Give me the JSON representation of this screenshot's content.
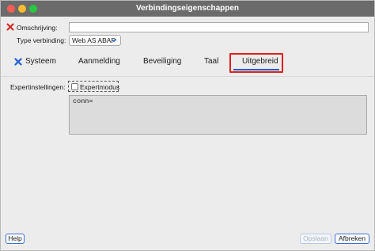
{
  "window": {
    "title": "Verbindingseigenschappen"
  },
  "form": {
    "omschrijving_label": "Omschrijving:",
    "omschrijving_value": "",
    "type_label": "Type verbinding:",
    "type_value": "Web AS ABAP"
  },
  "tabs": [
    {
      "label": "Systeem"
    },
    {
      "label": "Aanmelding"
    },
    {
      "label": "Beveiliging"
    },
    {
      "label": "Taal"
    },
    {
      "label": "Uitgebreid"
    }
  ],
  "expert": {
    "label": "Expertinstellingen:",
    "checkbox_label": "Expertmodus",
    "checked": false,
    "textarea_value": "conn="
  },
  "footer": {
    "help": "Help",
    "save": "Opslaan",
    "cancel": "Afbreken"
  },
  "colors": {
    "error_icon": "#d42121",
    "systeem_icon": "#1f5fd1",
    "active_tab_underline": "#1f5fd1",
    "highlight_box": "#e01d1d"
  }
}
